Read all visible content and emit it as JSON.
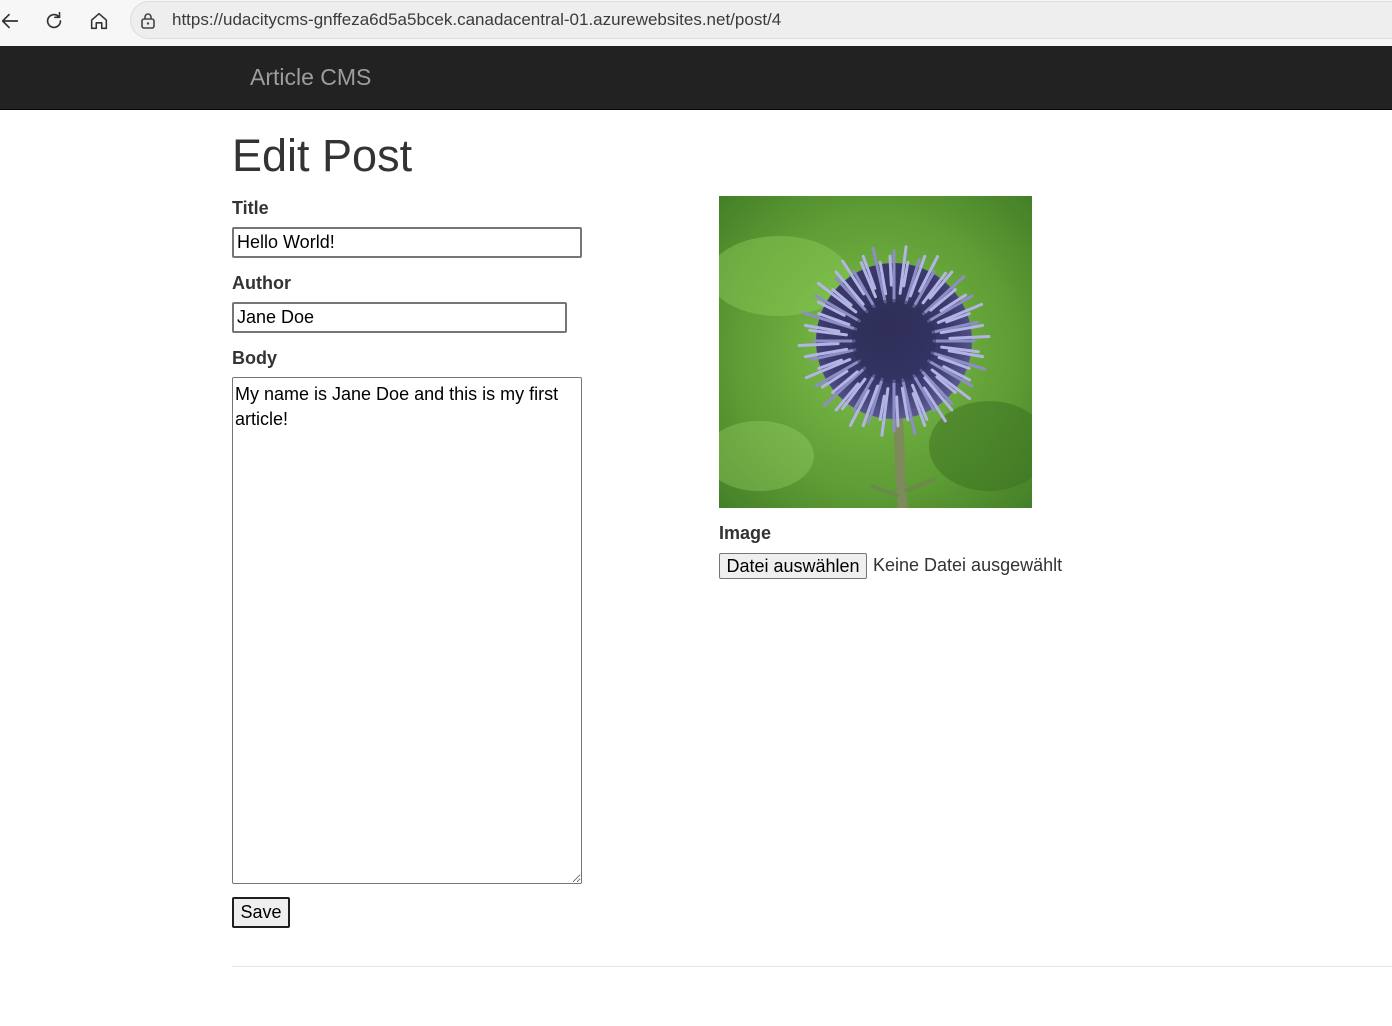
{
  "browser": {
    "url": "https://udacitycms-gnffeza6d5a5bcek.canadacentral-01.azurewebsites.net/post/4",
    "icons": [
      "back-arrow-icon",
      "reload-icon",
      "home-icon",
      "lock-icon"
    ]
  },
  "navbar": {
    "brand": "Article CMS",
    "background": "#222222",
    "brand_color": "#9d9d9d"
  },
  "page": {
    "title": "Edit Post"
  },
  "form": {
    "title_label": "Title",
    "title_value": "Hello World!",
    "author_label": "Author",
    "author_value": "Jane Doe",
    "body_label": "Body",
    "body_value": "My name is Jane Doe and this is my first article!",
    "image_label": "Image",
    "file_button_label": "Datei auswählen",
    "file_status": "Keine Datei ausgewählt",
    "save_label": "Save"
  },
  "image": {
    "subject": "globe-thistle-flower-photo"
  }
}
